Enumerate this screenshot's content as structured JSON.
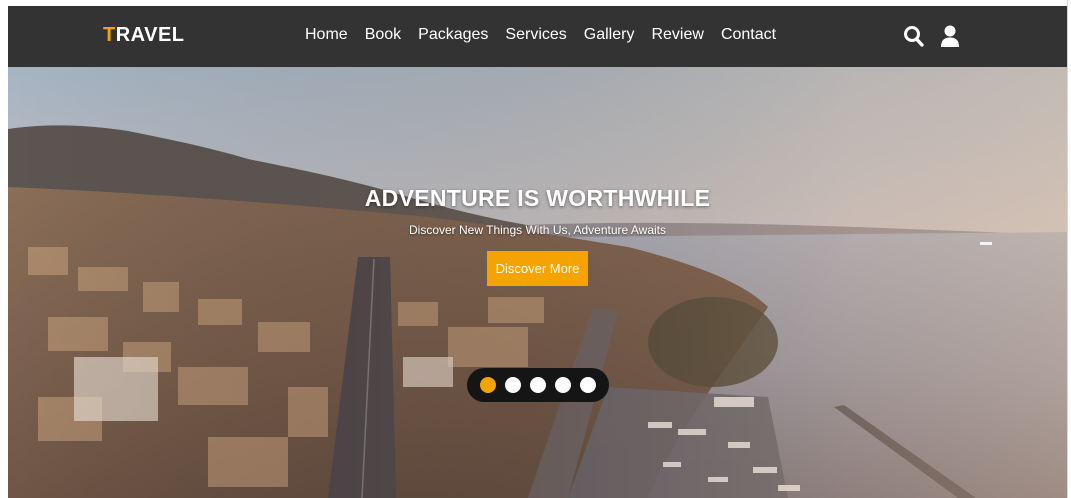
{
  "navbar": {
    "logo_first_letter": "T",
    "logo_rest": "RAVEL",
    "links": [
      "Home",
      "Book",
      "Packages",
      "Services",
      "Gallery",
      "Review",
      "Contact"
    ],
    "icons": [
      "search-icon",
      "user-icon"
    ]
  },
  "hero": {
    "title": "ADVENTURE IS WORTHWHILE",
    "subtitle": "Discover New Things With Us, Adventure Awaits",
    "cta_label": "Discover More",
    "slides_total": 5,
    "active_slide": 1
  },
  "colors": {
    "accent": "#f5a300",
    "navbar_bg": "#333333",
    "dots_bg": "#151515"
  }
}
